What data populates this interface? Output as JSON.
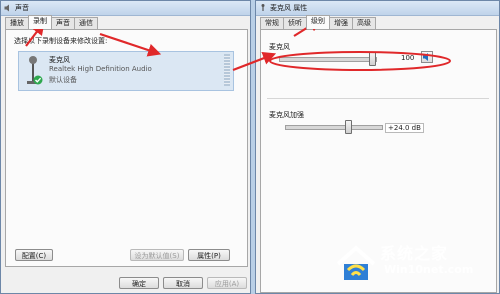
{
  "left_window": {
    "title": "声音",
    "tabs": [
      "播放",
      "录制",
      "声音",
      "通信"
    ],
    "instruction": "选择以下录制设备来修改设置:",
    "device": {
      "name": "麦克风",
      "driver": "Realtek High Definition Audio",
      "status": "默认设备"
    },
    "configure_label": "配置(C)",
    "set_default_label": "设为默认值(S)",
    "properties_label": "属性(P)",
    "ok_label": "确定",
    "cancel_label": "取消",
    "apply_label": "应用(A)"
  },
  "right_window": {
    "title": "麦克风 属性",
    "tabs": [
      "常规",
      "侦听",
      "级别",
      "增强",
      "高级"
    ],
    "mic_label": "麦克风",
    "mic_value": "100",
    "mic_level": 100,
    "boost_label": "麦克风加强",
    "boost_value": "+24.0 dB",
    "boost_level": 0.67
  },
  "watermark": {
    "brand": "系统之家",
    "url": "Win10net.com"
  },
  "colors": {
    "arrow": "#e0282a",
    "accent": "#1f6fc0"
  }
}
